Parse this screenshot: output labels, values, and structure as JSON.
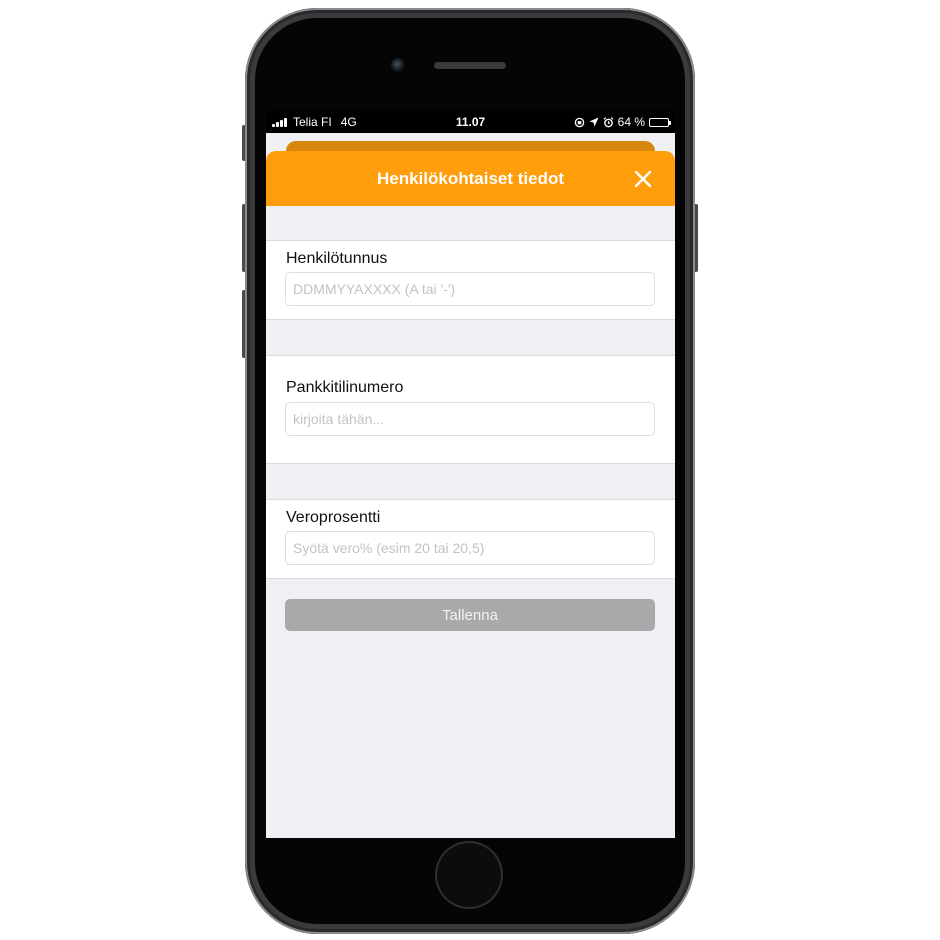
{
  "status_bar": {
    "carrier": "Telia FI",
    "network": "4G",
    "time": "11.07",
    "battery": "64 %",
    "battery_level": 0.64,
    "battery_color": "#ffcc00"
  },
  "modal": {
    "title": "Henkilökohtaiset tiedot",
    "header_color": "#ff9d0a",
    "close_icon": "close-icon"
  },
  "form": {
    "fields": [
      {
        "label": "Henkilötunnus",
        "value": "",
        "placeholder": "DDMMYYAXXXX (A tai '-')"
      },
      {
        "label": "Pankkitilinumero",
        "value": "",
        "placeholder": "kirjoita tähän..."
      },
      {
        "label": "Veroprosentti",
        "value": "",
        "placeholder": "Syötä vero% (esim 20 tai 20,5)"
      }
    ],
    "save_label": "Tallenna"
  }
}
